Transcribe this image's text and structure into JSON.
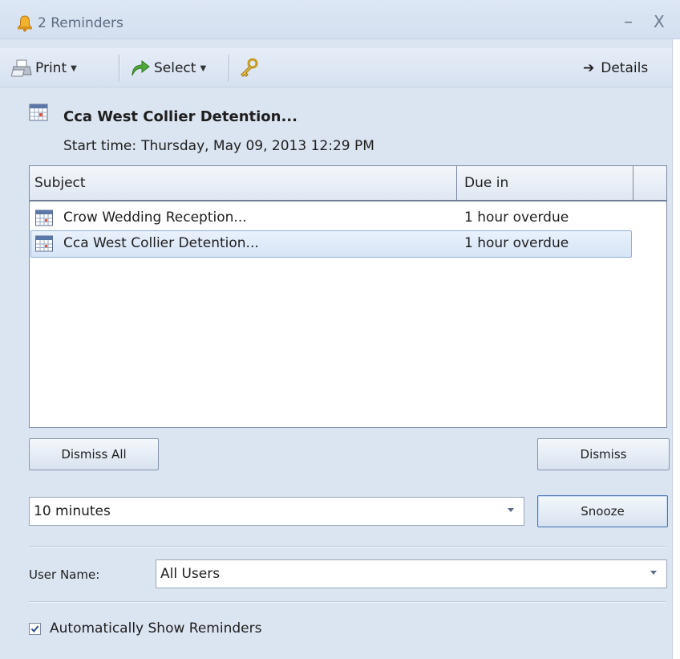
{
  "window": {
    "title": "2 Reminders",
    "minimize_glyph": "–",
    "close_glyph": "X"
  },
  "toolbar": {
    "print_label": "Print",
    "select_label": "Select",
    "details_label": "Details"
  },
  "reminder": {
    "title": "Cca West Collier Detention...",
    "start_label": "Start time:",
    "start_value": "Thursday, May 09, 2013 12:29 PM"
  },
  "list": {
    "columns": [
      "Subject",
      "Due in"
    ],
    "rows": [
      {
        "subject": "Crow Wedding Reception...",
        "due": "1 hour overdue",
        "selected": false
      },
      {
        "subject": "Cca West Collier Detention...",
        "due": "1 hour overdue",
        "selected": true
      }
    ]
  },
  "buttons": {
    "dismiss_all": "Dismiss All",
    "dismiss": "Dismiss",
    "snooze": "Snooze"
  },
  "snooze": {
    "value": "10 minutes"
  },
  "user": {
    "label": "User Name:",
    "value": "All Users"
  },
  "auto_show": {
    "label": "Automatically Show Reminders",
    "checked": true
  }
}
